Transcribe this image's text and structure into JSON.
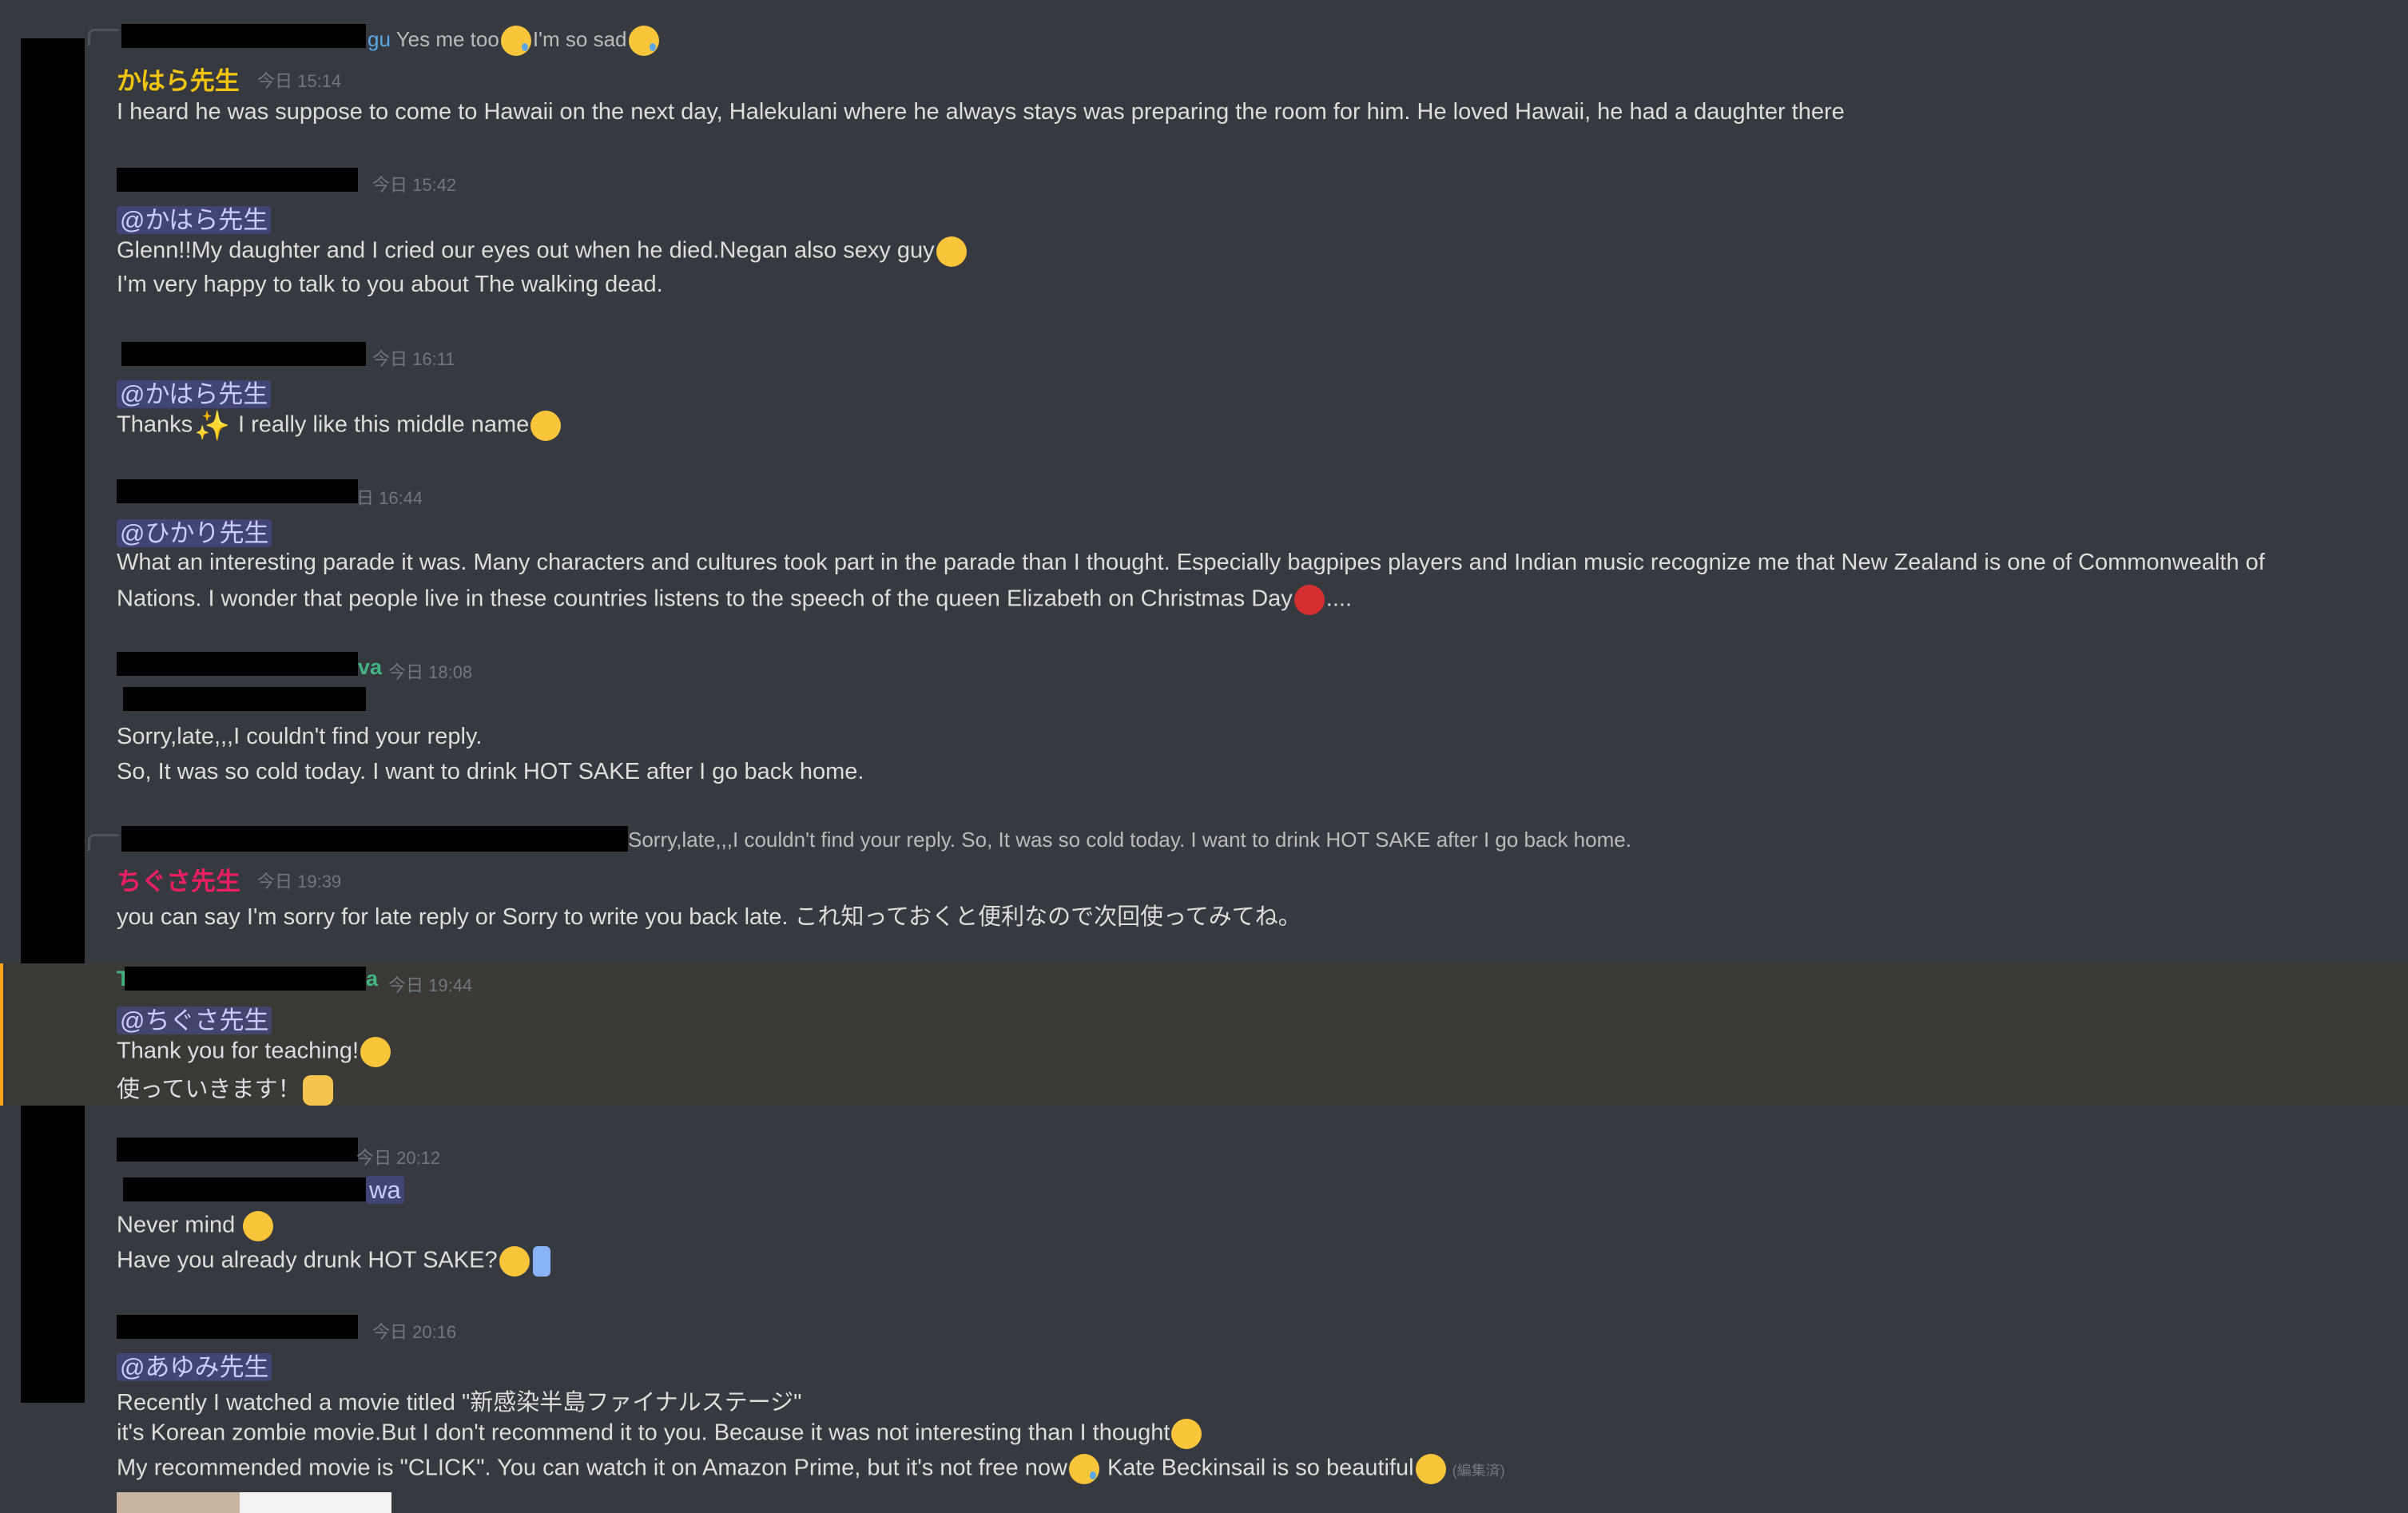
{
  "colors": {
    "background": "#36393f",
    "text": "#dcddde",
    "timestamp": "#72767d",
    "mention_bg": "#5865f24d",
    "mention_text": "#c9cdfb",
    "kahara_name": "#f1c40f",
    "chigusa_name": "#e91e63",
    "green_name": "#43b581",
    "highlight_bar": "#faa61a"
  },
  "messages": [
    {
      "reply_name_tail": "gu",
      "reply_text_1": "Yes me too",
      "reply_text_2": "I'm so sad",
      "author": "かはら先生",
      "timestamp": "今日 15:14",
      "lines": [
        "I heard he was suppose to come to Hawaii on the next day, Halekulani where he always stays was preparing the room for him. He loved Hawaii, he had a daughter there"
      ]
    },
    {
      "timestamp": "今日 15:42",
      "mention": "@かはら先生",
      "lines": [
        "Glenn!!My daughter and I cried our eyes out when he died.Negan also sexy guy",
        "I'm very happy to talk to you about The walking dead."
      ]
    },
    {
      "timestamp": "今日 16:11",
      "mention": "@かはら先生",
      "line_a": "Thanks",
      "line_b": " I really like this middle name"
    },
    {
      "timestamp": "日 16:44",
      "mention": "@ひかり先生",
      "lines": [
        "What an interesting parade it was. Many characters and cultures took part in the parade than I thought. Especially bagpipes players and Indian music recognize me that New Zealand is one of Commonwealth of",
        "Nations. I wonder that people live in these countries listens to the speech of the queen Elizabeth on Christmas Day"
      ],
      "trail": "...."
    },
    {
      "name_tail": "va",
      "timestamp": "今日 18:08",
      "lines": [
        "Sorry,late,,,I couldn't find your reply.",
        "So,   It was so cold today. I want to drink HOT SAKE after I go back home."
      ]
    },
    {
      "reply_text": "Sorry,late,,,I couldn't find your reply. So,   It was so cold today. I want to drink HOT SAKE after I go back home.",
      "author": "ちぐさ先生",
      "timestamp": "今日 19:39",
      "lines": [
        "you can say  I'm sorry for late reply or Sorry to write you back late.  これ知っておくと便利なので次回使ってみてね。"
      ]
    },
    {
      "name_head": "T",
      "name_tail": "a",
      "timestamp": "今日 19:44",
      "mention": "@ちぐさ先生",
      "lines": [
        "Thank you for teaching!",
        "使っていきます！"
      ]
    },
    {
      "timestamp": "今日 20:12",
      "mention_tail": "wa",
      "lines": [
        "Never mind ",
        "Have you already drunk HOT SAKE?"
      ]
    },
    {
      "timestamp": "今日 20:16",
      "mention": "@あゆみ先生",
      "lines": [
        "Recently I watched a movie titled \"新感染半島ファイナルステージ\"",
        "it's Korean zombie movie.But I don't recommend it to you. Because it was not interesting than I thought",
        "My recommended movie is \"CLICK\". You can watch it on Amazon Prime, but it's not free now"
      ],
      "line3_b": " Kate Beckinsail is so beautiful",
      "edited": "(編集済)"
    }
  ]
}
